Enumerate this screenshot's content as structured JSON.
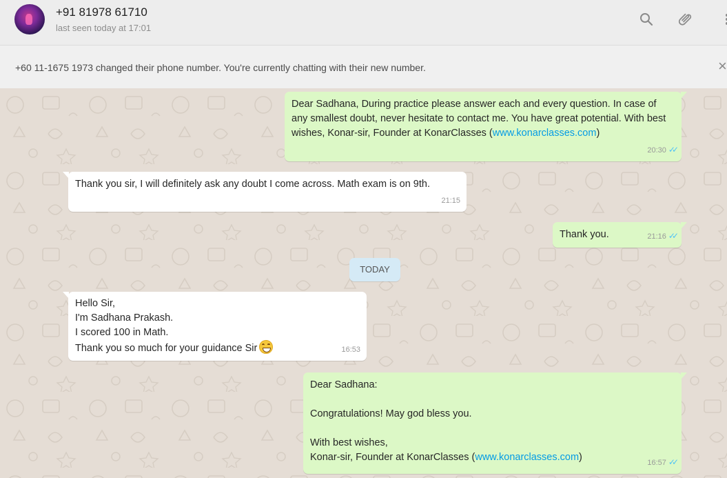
{
  "header": {
    "contact_name": "+91 81978 61710",
    "last_seen": "last seen today at 17:01",
    "icons": [
      "search-icon",
      "attach-icon",
      "menu-icon"
    ]
  },
  "notice": {
    "text": "+60 11-1675 1973 changed their phone number. You're currently chatting with their new number.",
    "close_glyph": "×"
  },
  "day_separator": "TODAY",
  "messages": [
    {
      "direction": "outgoing",
      "text": "Dear Sadhana, During practice please answer each and every question. In case of any smallest doubt, never hesitate to contact me. You have great potential. With best wishes, Konar-sir, Founder at KonarClasses (",
      "link": "www.konarclasses.com",
      "text_after": ")",
      "time": "20:30",
      "ticks": "✓✓"
    },
    {
      "direction": "incoming",
      "text": "Thank you sir, I will definitely ask any doubt I come across. Math exam is on 9th.",
      "time": "21:15"
    },
    {
      "direction": "outgoing",
      "text": "Thank you.",
      "time": "21:16",
      "ticks": "✓✓"
    },
    {
      "direction": "incoming",
      "text": "Hello Sir,\nI'm Sadhana Prakash.\nI scored 100 in Math.\nThank you so much for your guidance Sir",
      "emoji": "grinning-face",
      "time": "16:53"
    },
    {
      "direction": "outgoing",
      "text": "Dear Sadhana:\n\nCongratulations! May god bless you.\n\nWith best wishes,\nKonar-sir, Founder at KonarClasses (",
      "link": "www.konarclasses.com",
      "text_after": ")",
      "time": "16:57",
      "ticks": "✓✓"
    }
  ],
  "colors": {
    "outgoing_bubble": "#dcf8c6",
    "incoming_bubble": "#ffffff",
    "chat_background": "#e5ddd5",
    "link": "#039be5",
    "read_ticks": "#4fc3f7"
  }
}
